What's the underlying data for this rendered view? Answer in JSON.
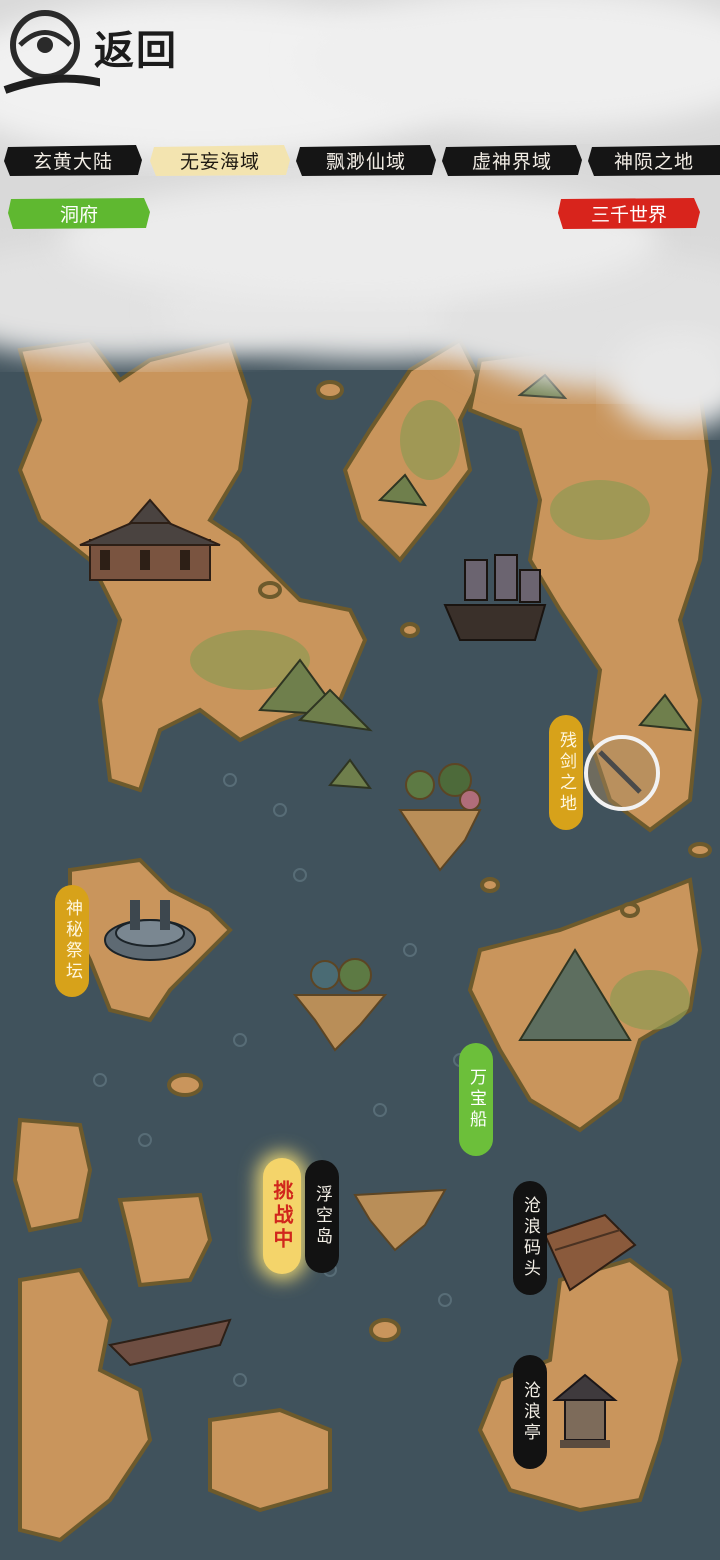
{
  "header": {
    "back_label": "返回"
  },
  "region_tabs": [
    {
      "label": "玄黄大陆",
      "selected": false
    },
    {
      "label": "无妄海域",
      "selected": true
    },
    {
      "label": "飘渺仙域",
      "selected": false
    },
    {
      "label": "虚神界域",
      "selected": false
    },
    {
      "label": "神陨之地",
      "selected": false
    }
  ],
  "buttons": {
    "cave_label": "洞府",
    "three_thousand_worlds_label": "三千世界"
  },
  "locations": {
    "broken_sword": "残剑之地",
    "mystic_altar": "神秘祭坛",
    "treasure_ship": "万宝船",
    "challenging": "挑战中",
    "floating_island": "浮空岛",
    "canglang_dock": "沧浪码头",
    "canglang_pavilion": "沧浪亭"
  },
  "colors": {
    "sea": "#3d4e58",
    "land": "#c9955c",
    "tab_black": "#151515",
    "tab_selected": "#f3e4b0",
    "green_button": "#5fb830",
    "red_button": "#d8241c",
    "gold_label": "#d7a21a",
    "green_label": "#6cbf3a",
    "challenge_label": "#f4d46a"
  }
}
